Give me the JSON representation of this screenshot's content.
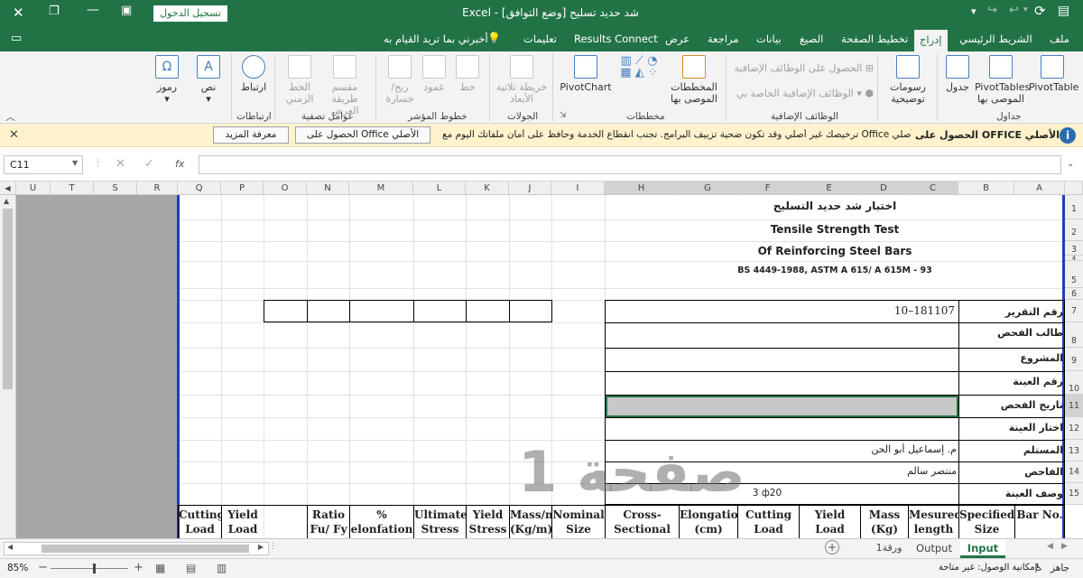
{
  "titlebar": {
    "doc_title": "شد حديد تسليح",
    "mode": "[وضع التوافق]",
    "app": "Excel",
    "signin": "تسجيل الدخول"
  },
  "tabs": [
    "ملف",
    "الشريط الرئيسي",
    "إدراج",
    "تخطيط الصفحة",
    "الصيغ",
    "بيانات",
    "مراجعة",
    "عرض",
    "Results Connect",
    "تعليمات",
    "أخبرني بما تريد القيام به"
  ],
  "ribbon": {
    "tables": {
      "pivottable": "PivotTable",
      "recommended_pivot": "PivotTables الموصى بها",
      "table": "جدول",
      "group": "جداول"
    },
    "illustrations": {
      "label": "رسومات توضيحية"
    },
    "addins": {
      "get": "الحصول على الوظائف الإضافية",
      "my": "الوظائف الإضافية الخاصة بي",
      "group": "الوظائف الإضافية"
    },
    "charts": {
      "recommended": "المخططات الموصى بها",
      "pivotchart": "PivotChart",
      "group": "مخططات"
    },
    "tours": {
      "map3d": "خريطة ثلاثية الأبعاد",
      "group": "الجولات"
    },
    "sparklines": {
      "line": "خط",
      "column": "عمود",
      "winloss": "ربح/خسارة",
      "group": "خطوط المؤشر"
    },
    "filters": {
      "slicer": "مقسم طريقة العرض",
      "timeline": "الخط الزمني",
      "group": "عوامل تصفية"
    },
    "links": {
      "link": "ارتباط",
      "group": "ارتباطات"
    },
    "text": {
      "text": "نص",
      "symbols": "رموز"
    }
  },
  "infobar": {
    "title": "الحصول على OFFICE الأصلي",
    "message": "ترخيصك غير أصلي وقد تكون ضحية تزييف البرامج. تجنب انقطاع الخدمة وحافظ على أمان ملفاتك اليوم مع Office الأصلي.",
    "get_button": "الحصول على Office الأصلي",
    "learn_button": "معرفة المزيد"
  },
  "formula_bar": {
    "name_box": "C11",
    "fx": "fx",
    "content": ""
  },
  "columns": [
    "A",
    "B",
    "C",
    "D",
    "E",
    "F",
    "G",
    "H",
    "I",
    "J",
    "K",
    "L",
    "M",
    "N",
    "O",
    "P",
    "Q",
    "R",
    "S",
    "T",
    "U"
  ],
  "rows": [
    "1",
    "2",
    "3",
    "4",
    "5",
    "6",
    "7",
    "8",
    "9",
    "10",
    "11",
    "12",
    "13",
    "14",
    "15"
  ],
  "sheet": {
    "title_ar": "اختبار شد حديد التسليح",
    "title_en1": "Tensile Strength Test",
    "title_en2": "Of Reinforcing Steel Bars",
    "standard": "BS 4449-1988, ASTM A 615/ A 615M - 93",
    "labels": [
      "رقم التقرير",
      "طالب الفحص",
      "المشروع",
      "رقم العينة",
      "تاريخ الفحص",
      "اختار العينة",
      "المستلم",
      "الفاحص",
      "وصف العينة"
    ],
    "report_no": "10–181107",
    "receiver": "م. إسماعيل أبو الحن",
    "tester": "منتصر سالم",
    "sample_desc": "3 ф20",
    "watermark": "صفحة 1",
    "headers": [
      {
        "key": "bar_no",
        "text": "Bar No."
      },
      {
        "key": "spec_size",
        "text": "Specified Size"
      },
      {
        "key": "mes_len",
        "text": "Mesured length"
      },
      {
        "key": "mass",
        "text": "Mass (Kg)"
      },
      {
        "key": "yield_load",
        "text": "Yield Load"
      },
      {
        "key": "cut_load",
        "text": "Cutting Load (KN)"
      },
      {
        "key": "elong",
        "text": "Elongation (cm)"
      },
      {
        "key": "cross",
        "text": "Cross-Sectional"
      },
      {
        "key": "nominal",
        "text": "Nominal Size"
      },
      {
        "key": "mass_m",
        "text": "Mass/m (Kg/m)"
      },
      {
        "key": "yield_stress",
        "text": "Yield Stress"
      },
      {
        "key": "ult_stress",
        "text": "Ultimate Stress"
      },
      {
        "key": "elong_pct",
        "text": "% elonfation"
      },
      {
        "key": "ratio",
        "text": "Ratio Fu/ Fy"
      },
      {
        "key": "yield_load2",
        "text": "Yield Load"
      },
      {
        "key": "cutting_load2",
        "text": "Cutting Load"
      }
    ]
  },
  "sheet_tabs": [
    "Input",
    "Output",
    "ورقة1"
  ],
  "status": {
    "ready": "جاهز",
    "accessibility": "إمكانية الوصول: غير متاحة",
    "zoom": "85%"
  }
}
